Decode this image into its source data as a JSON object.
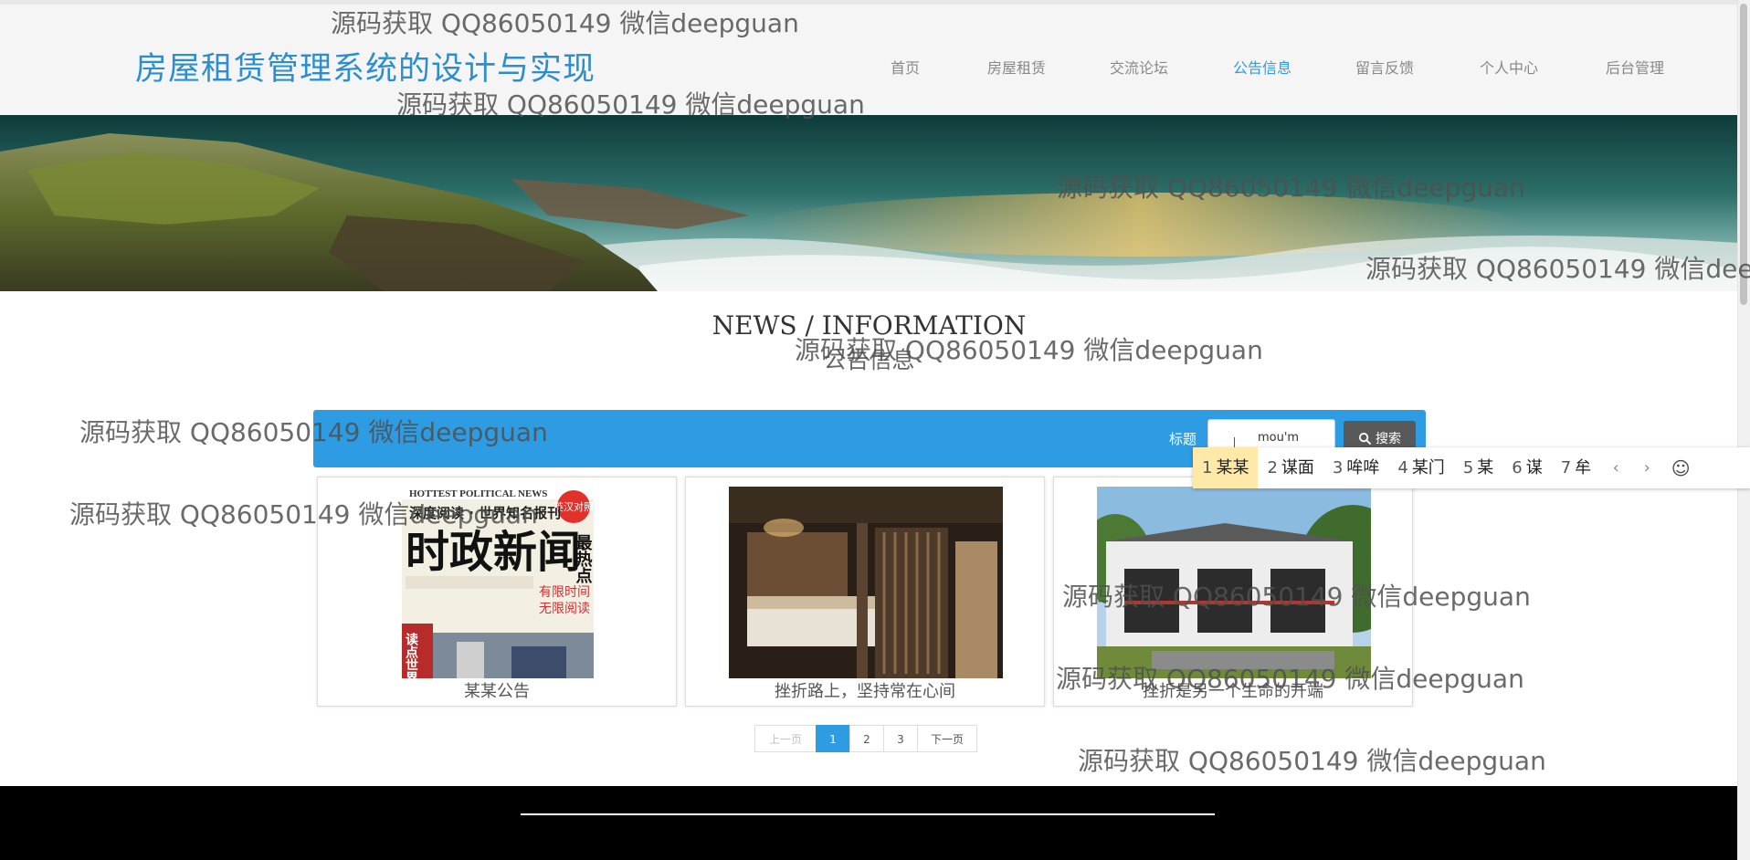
{
  "header": {
    "site_title": "房屋租赁管理系统的设计与实现",
    "nav": [
      {
        "label": "首页",
        "name": "nav-home"
      },
      {
        "label": "房屋租赁",
        "name": "nav-rental"
      },
      {
        "label": "交流论坛",
        "name": "nav-forum"
      },
      {
        "label": "公告信息",
        "name": "nav-notice",
        "active": true
      },
      {
        "label": "留言反馈",
        "name": "nav-feedback"
      },
      {
        "label": "个人中心",
        "name": "nav-profile"
      },
      {
        "label": "后台管理",
        "name": "nav-admin"
      }
    ]
  },
  "section": {
    "title_en": "NEWS / INFORMATION",
    "title_cn": "公告信息"
  },
  "search": {
    "label": "标题",
    "value": "mou'm",
    "button_label": "搜索"
  },
  "ime": {
    "candidates": [
      {
        "n": "1",
        "text": "某某",
        "selected": true
      },
      {
        "n": "2",
        "text": "谋面"
      },
      {
        "n": "3",
        "text": "哞哞"
      },
      {
        "n": "4",
        "text": "某门"
      },
      {
        "n": "5",
        "text": "某"
      },
      {
        "n": "6",
        "text": "谋"
      },
      {
        "n": "7",
        "text": "牟"
      }
    ],
    "prev": "‹",
    "next": "›",
    "emoji": "☺"
  },
  "cards": [
    {
      "caption": "某某公告",
      "image": "news-book-cover",
      "cover_texts": {
        "top": "HOTTEST POLITICAL NEWS",
        "subtitle": "深度阅读 · 世界知名报刊",
        "main": "时政新闻",
        "side": "最热点",
        "badge": "英汉对照",
        "promo1": "有限时间",
        "promo2": "无限阅读",
        "vertical": "读点世界 感受最地道"
      }
    },
    {
      "caption": "挫折路上，坚持常在心间",
      "image": "hotel-bedroom"
    },
    {
      "caption": "挫折是另一个生命的开端",
      "image": "white-houses"
    }
  ],
  "pagination": {
    "prev": "上一页",
    "pages": [
      "1",
      "2",
      "3"
    ],
    "current": "1",
    "next": "下一页"
  },
  "watermark": "源码获取 QQ86050149 微信deepguan",
  "colors": {
    "accent": "#2d9ce3",
    "title": "#2d8ecf",
    "header_bg": "#f5f5f5",
    "footer_bg": "#000000",
    "ime_selected": "#ffe9a8"
  }
}
